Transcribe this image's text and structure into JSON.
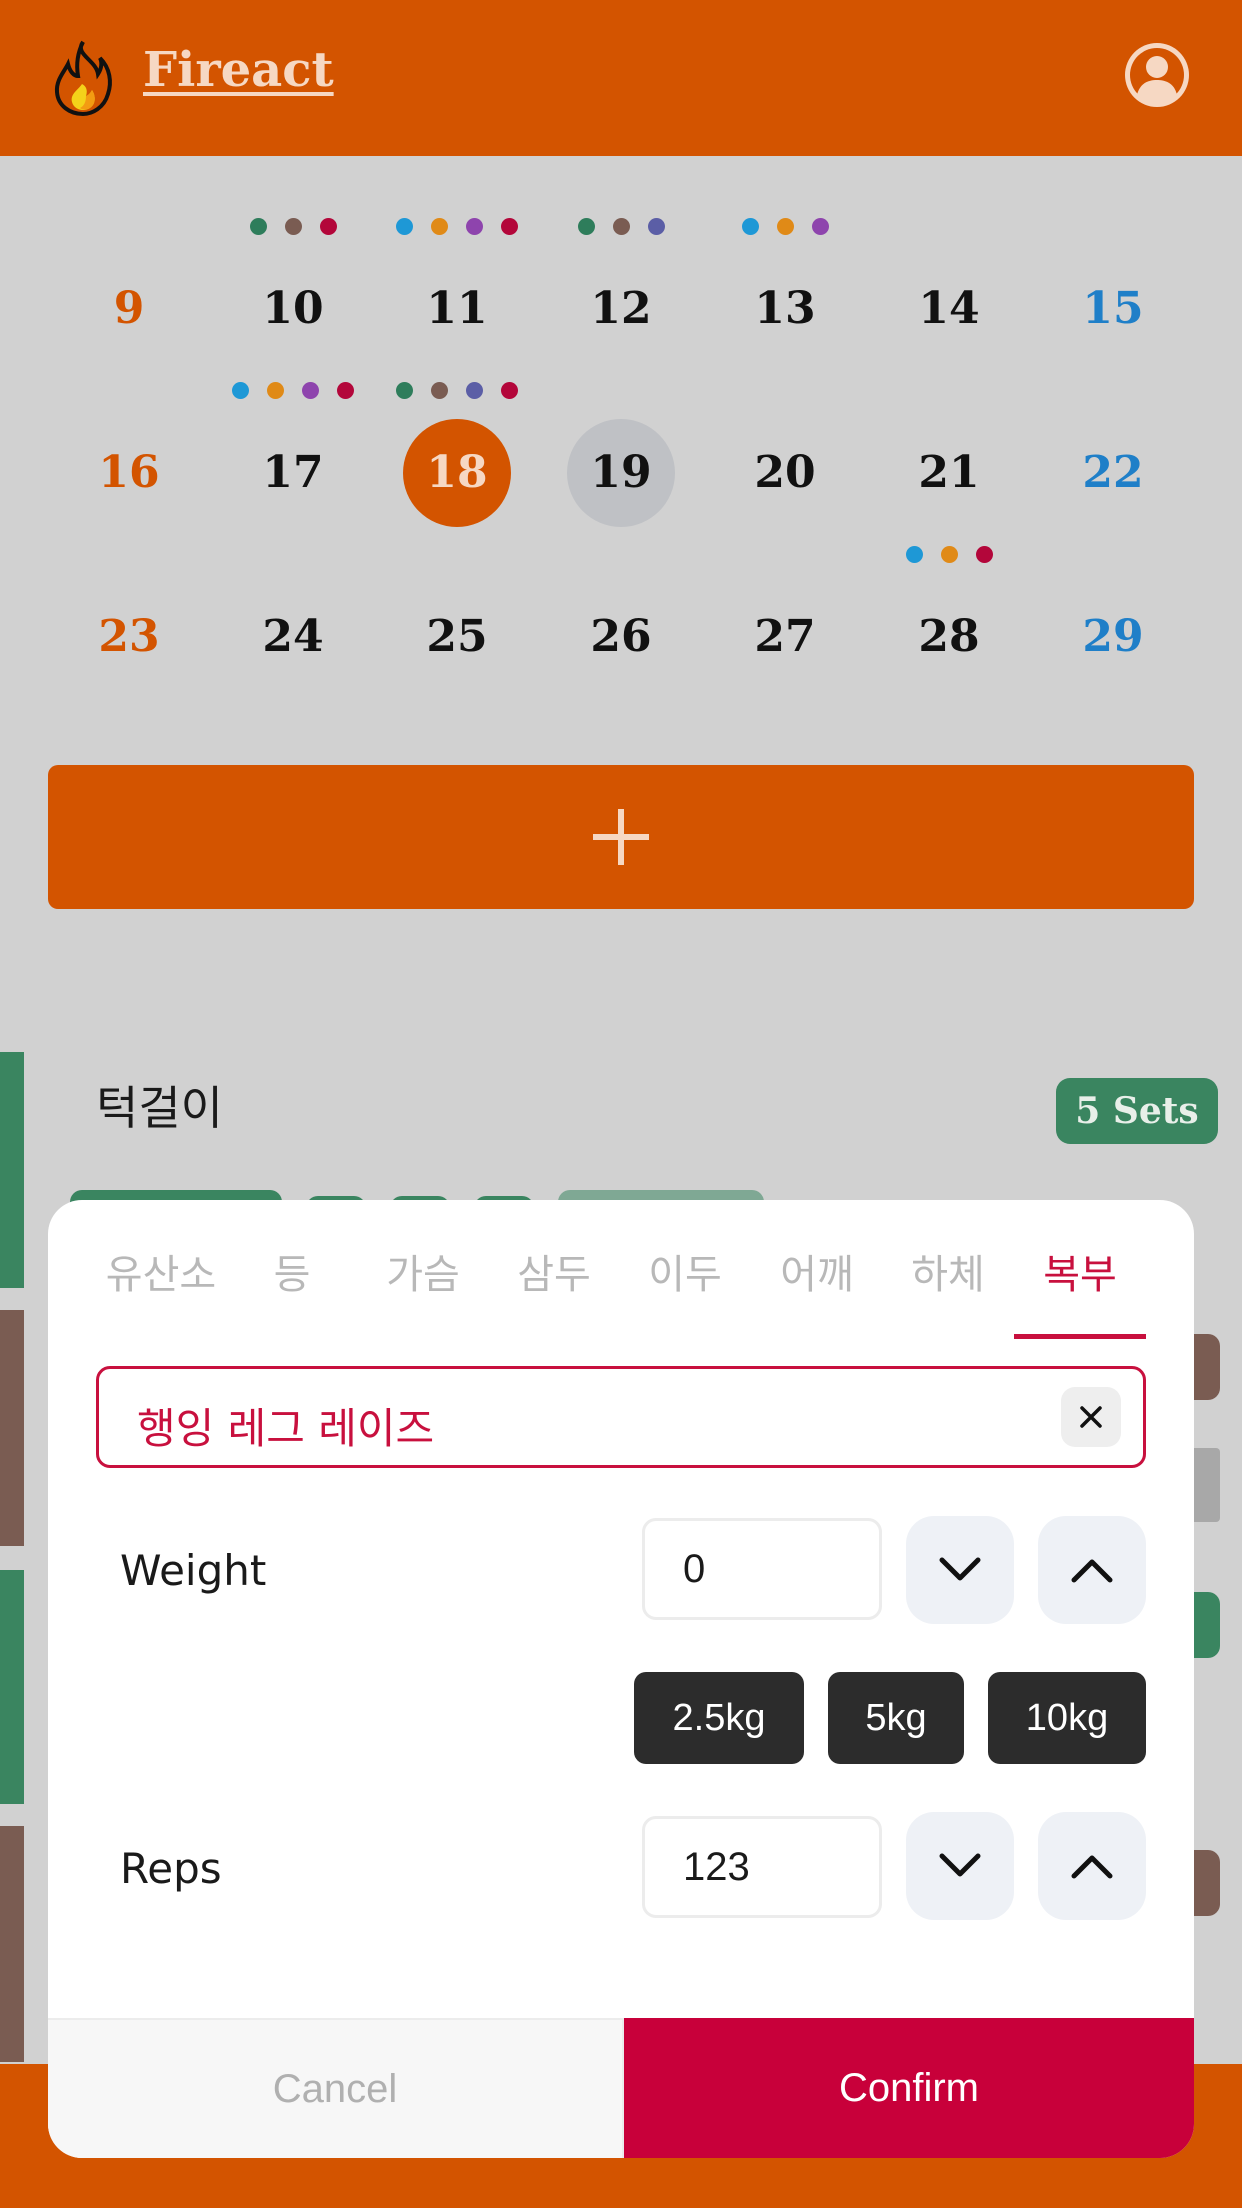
{
  "app": {
    "title": "Fireact"
  },
  "calendar": {
    "rows": [
      {
        "days": [
          {
            "num": "9",
            "kind": "sun",
            "dots": []
          },
          {
            "num": "10",
            "kind": "",
            "dots": [
              "#2e7d5b",
              "#7a5c52",
              "#b3063a"
            ]
          },
          {
            "num": "11",
            "kind": "",
            "dots": [
              "#1e98d6",
              "#e08a17",
              "#8e44ad",
              "#b3063a"
            ]
          },
          {
            "num": "12",
            "kind": "",
            "dots": [
              "#2e7d5b",
              "#7a5c52",
              "#5b5ea6"
            ]
          },
          {
            "num": "13",
            "kind": "",
            "dots": [
              "#1e98d6",
              "#e08a17",
              "#8e44ad"
            ]
          },
          {
            "num": "14",
            "kind": "",
            "dots": []
          },
          {
            "num": "15",
            "kind": "sat",
            "dots": []
          }
        ]
      },
      {
        "days": [
          {
            "num": "16",
            "kind": "sun",
            "dots": []
          },
          {
            "num": "17",
            "kind": "",
            "dots": [
              "#1e98d6",
              "#e08a17",
              "#8e44ad",
              "#b3063a"
            ]
          },
          {
            "num": "18",
            "kind": "selected",
            "dots": [
              "#2e7d5b",
              "#7a5c52",
              "#5b5ea6",
              "#b3063a"
            ]
          },
          {
            "num": "19",
            "kind": "today",
            "dots": []
          },
          {
            "num": "20",
            "kind": "",
            "dots": []
          },
          {
            "num": "21",
            "kind": "",
            "dots": []
          },
          {
            "num": "22",
            "kind": "sat",
            "dots": []
          }
        ]
      },
      {
        "days": [
          {
            "num": "23",
            "kind": "sun",
            "dots": []
          },
          {
            "num": "24",
            "kind": "",
            "dots": []
          },
          {
            "num": "25",
            "kind": "",
            "dots": []
          },
          {
            "num": "26",
            "kind": "",
            "dots": []
          },
          {
            "num": "27",
            "kind": "",
            "dots": []
          },
          {
            "num": "28",
            "kind": "",
            "dots": [
              "#1e98d6",
              "#e08a17",
              "#b3063a"
            ]
          },
          {
            "num": "29",
            "kind": "sat",
            "dots": []
          }
        ]
      }
    ]
  },
  "list": {
    "title": "턱걸이",
    "sets": "5 Sets"
  },
  "modal": {
    "tabs": [
      "유산소",
      "등",
      "가슴",
      "삼두",
      "이두",
      "어깨",
      "하체",
      "복부"
    ],
    "active_tab": "복부",
    "search": {
      "value": "행잉 레그 레이즈"
    },
    "weight": {
      "label": "Weight",
      "value": "0"
    },
    "presets": [
      "2.5kg",
      "5kg",
      "10kg"
    ],
    "reps": {
      "label": "Reps",
      "value": "123"
    },
    "cancel": "Cancel",
    "confirm": "Confirm"
  },
  "colors": {
    "accent": "#d35400",
    "primary": "#c8003a",
    "green": "#3a8560"
  }
}
